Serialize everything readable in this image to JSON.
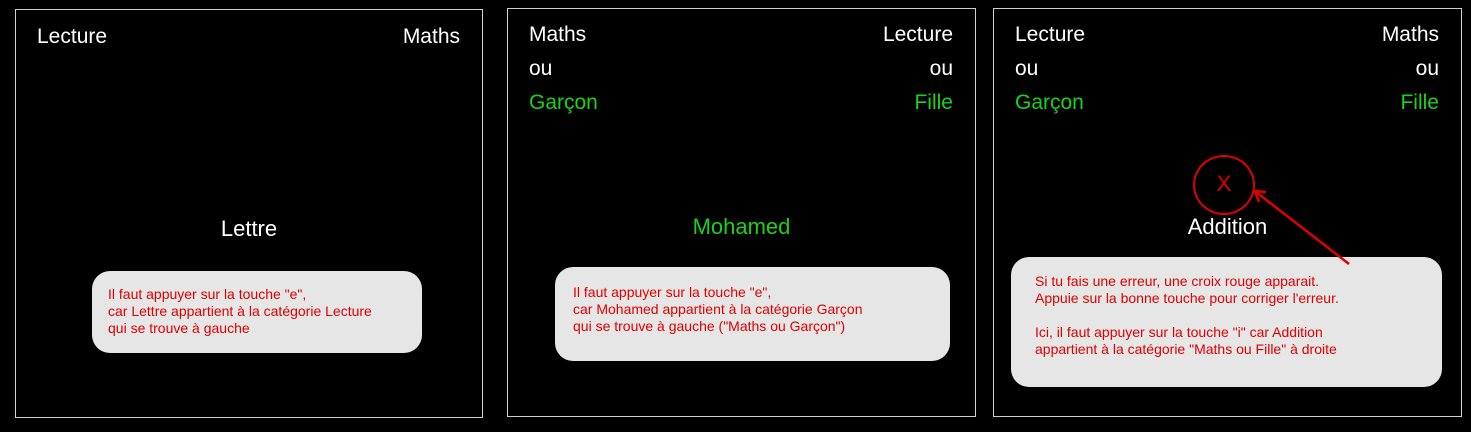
{
  "panels": [
    {
      "left_top": "Lecture",
      "right_top": "Maths",
      "stimulus": "Lettre",
      "bubble_lines": [
        "Il faut appuyer sur la touche \"e\",",
        "car Lettre appartient à la catégorie Lecture",
        "qui se trouve à gauche"
      ]
    },
    {
      "left_top": "Maths",
      "right_top": "Lecture",
      "left_mid": "ou",
      "right_mid": "ou",
      "left_bottom": "Garçon",
      "right_bottom": "Fille",
      "stimulus": "Mohamed",
      "bubble_lines": [
        "Il faut appuyer sur la touche \"e\",",
        "car Mohamed appartient à la catégorie Garçon",
        "qui se trouve à gauche (\"Maths ou Garçon\")"
      ]
    },
    {
      "left_top": "Lecture",
      "right_top": "Maths",
      "left_mid": "ou",
      "right_mid": "ou",
      "left_bottom": "Garçon",
      "right_bottom": "Fille",
      "error_mark": "X",
      "stimulus": "Addition",
      "bubble_lines": [
        "Si tu fais une erreur, une croix rouge apparait.",
        "Appuie sur la bonne touche pour corriger l'erreur.",
        "",
        "Ici, il faut appuyer sur la touche \"i\" car Addition",
        "appartient à la catégorie \"Maths ou Fille\" à droite"
      ]
    }
  ],
  "colors": {
    "background": "#000000",
    "category_text": "#ffffff",
    "green_text": "#19d419",
    "bubble_bg": "#e6e6e6",
    "bubble_text": "#e00000",
    "error_red": "#e00000"
  }
}
